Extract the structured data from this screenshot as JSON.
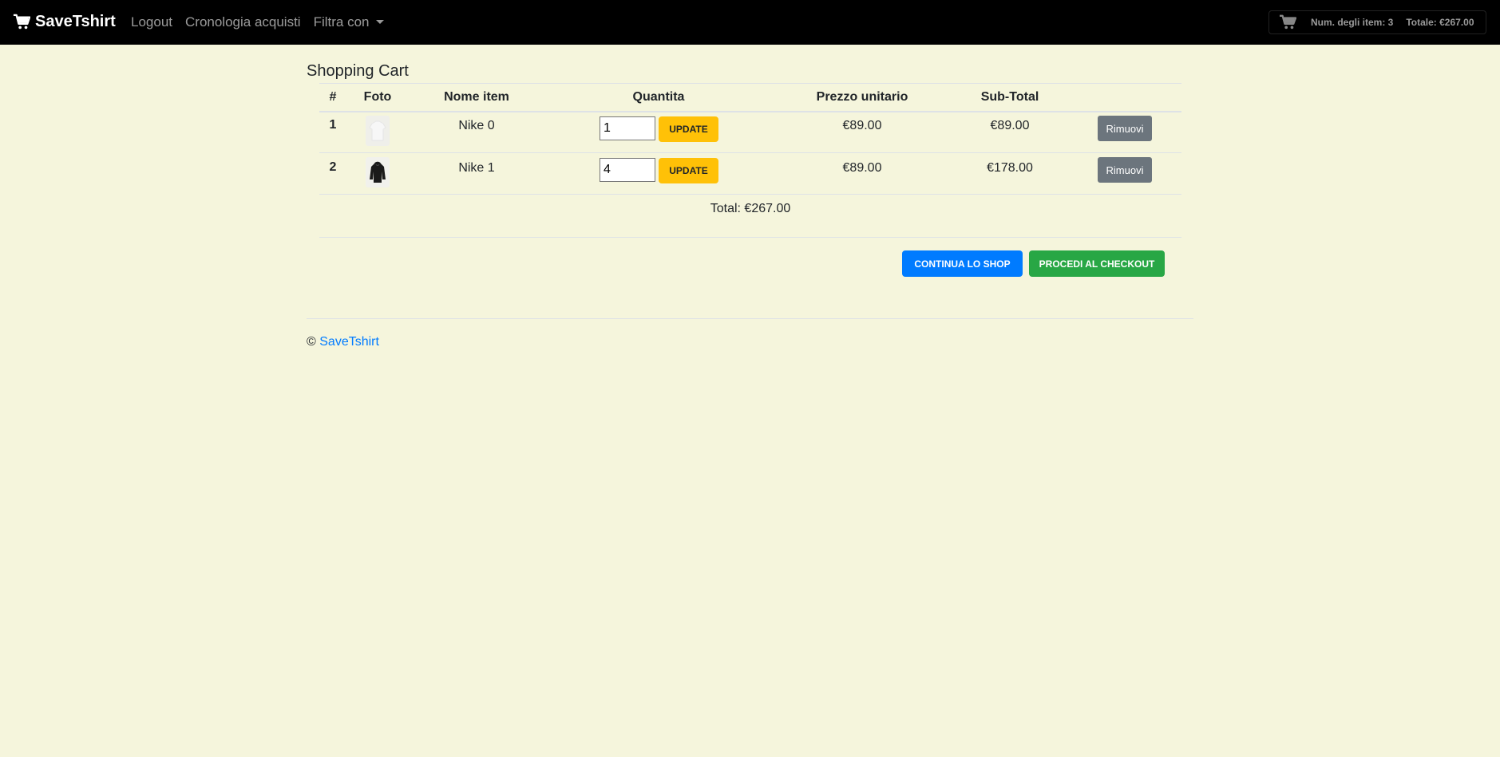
{
  "navbar": {
    "brand": "SaveTshirt",
    "links": [
      "Logout",
      "Cronologia acquisti",
      "Filtra con"
    ],
    "cart_count": "Num. degli item: 3",
    "cart_total": "Totale: €267.00"
  },
  "page": {
    "title": "Shopping Cart"
  },
  "table": {
    "headers": [
      "#",
      "Foto",
      "Nome item",
      "Quantita",
      "Prezzo unitario",
      "Sub-Total"
    ],
    "rows": [
      {
        "num": "1",
        "name": "Nike 0",
        "qty": "1",
        "price": "€89.00",
        "subtotal": "€89.00",
        "update": "UPDATE",
        "remove": "Rimuovi",
        "photo": "white-tshirt"
      },
      {
        "num": "2",
        "name": "Nike 1",
        "qty": "4",
        "price": "€89.00",
        "subtotal": "€178.00",
        "update": "UPDATE",
        "remove": "Rimuovi",
        "photo": "black-hoodie"
      }
    ],
    "total": "Total: €267.00"
  },
  "actions": {
    "continue": "CONTINUA LO SHOP",
    "checkout": "PROCEDI AL CHECKOUT"
  },
  "footer": {
    "copyright": "©",
    "link": "SaveTshirt"
  },
  "colors": {
    "background": "#f5f5dc",
    "navbar": "#000000",
    "update": "#ffc107",
    "remove": "#6c757d",
    "continue": "#007bff",
    "checkout": "#28a745",
    "link": "#007bff"
  }
}
